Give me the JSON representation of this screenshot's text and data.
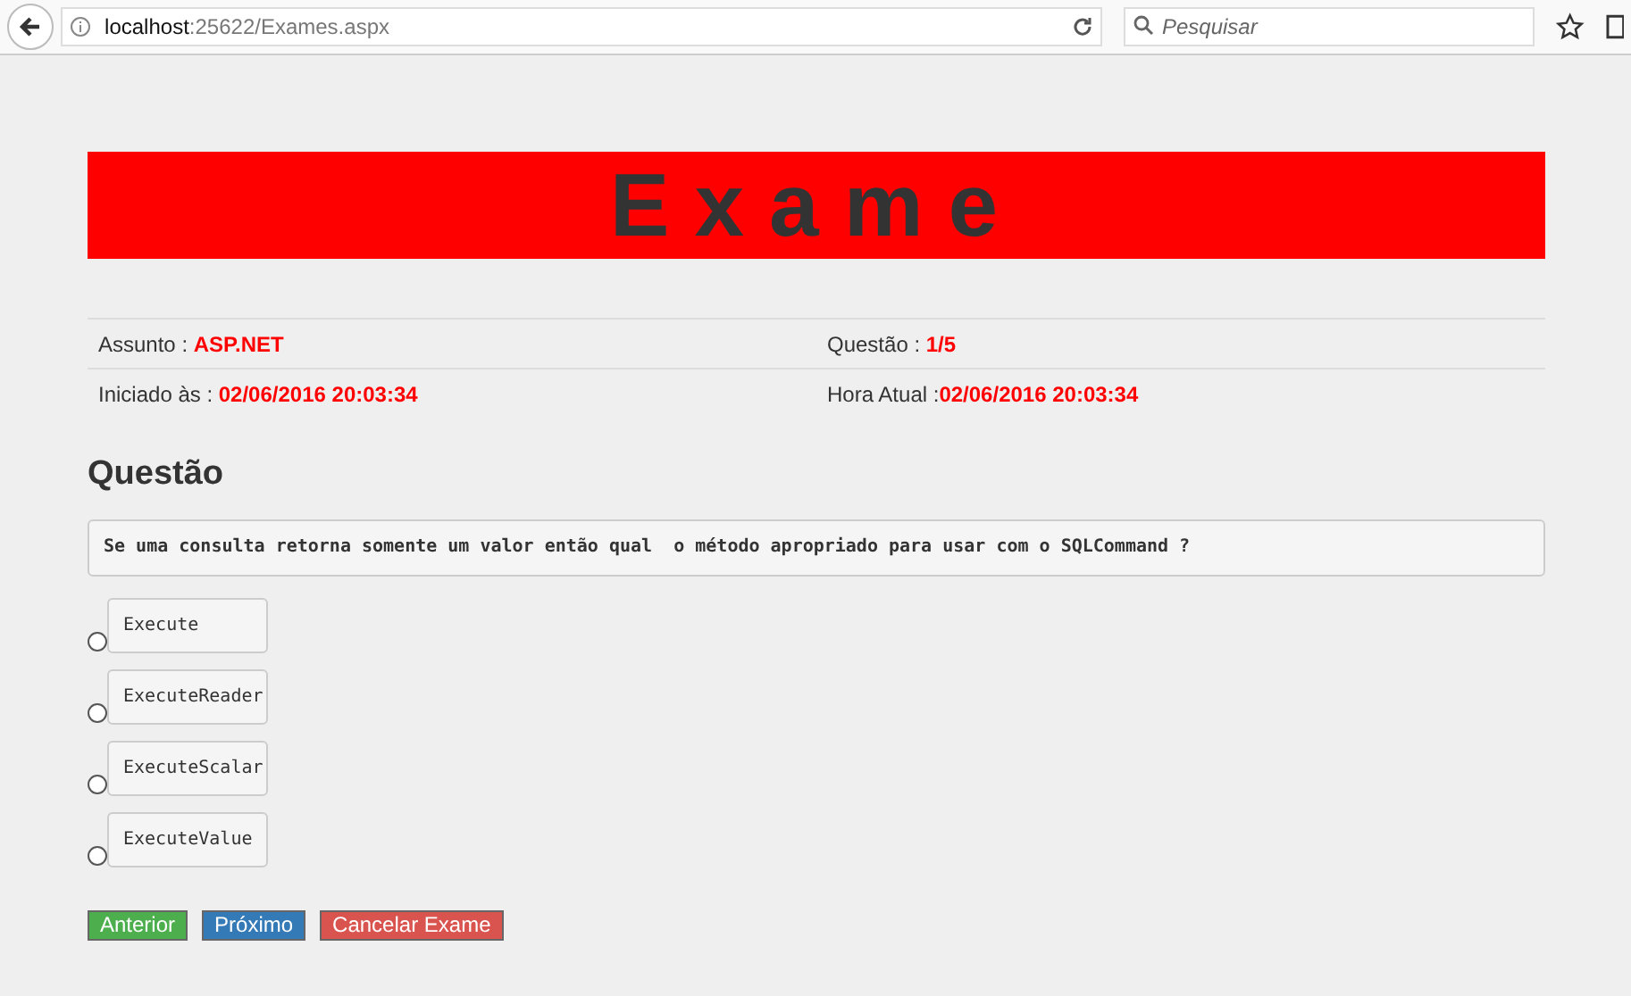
{
  "browser": {
    "url_host": "localhost",
    "url_path": ":25622/Exames.aspx",
    "search": {
      "placeholder": "Pesquisar"
    }
  },
  "banner": {
    "title": "Exame"
  },
  "info": [
    {
      "label": "Assunto : ",
      "value": "ASP.NET"
    },
    {
      "label": "Questão : ",
      "value": "1/5"
    },
    {
      "label": "Iniciado às : ",
      "value": "02/06/2016 20:03:34"
    },
    {
      "label": "Hora Atual :",
      "value": "02/06/2016 20:03:34"
    }
  ],
  "question": {
    "heading": "Questão",
    "text": "Se uma consulta retorna somente um valor então qual  o método apropriado para usar com o SQLCommand ?"
  },
  "options": [
    {
      "label": "Execute",
      "selected": false
    },
    {
      "label": "ExecuteReader",
      "selected": false
    },
    {
      "label": "ExecuteScalar",
      "selected": false
    },
    {
      "label": "ExecuteValue",
      "selected": false
    }
  ],
  "buttons": [
    {
      "label": "Anterior",
      "color": "#4cae4c"
    },
    {
      "label": "Próximo",
      "color": "#337ab7"
    },
    {
      "label": "Cancelar Exame",
      "color": "#d9534f"
    }
  ]
}
